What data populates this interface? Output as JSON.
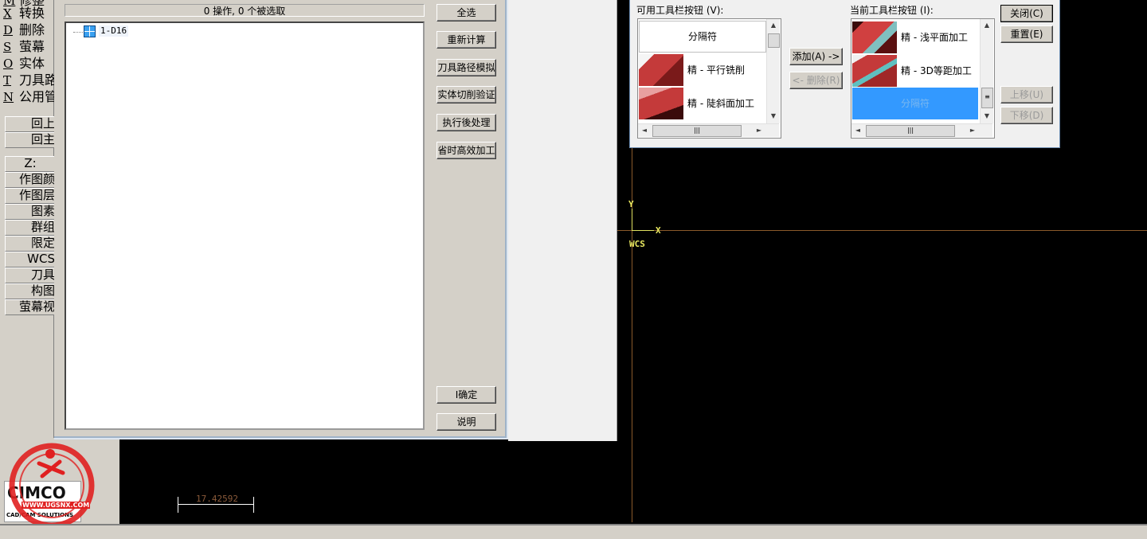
{
  "left_menu": {
    "items": [
      {
        "key": "X",
        "label": "转换"
      },
      {
        "key": "D",
        "label": "删除"
      },
      {
        "key": "S",
        "label": "萤幕"
      },
      {
        "key": "O",
        "label": "实体"
      },
      {
        "key": "T",
        "label": "刀具路"
      },
      {
        "key": "N",
        "label": "公用管"
      }
    ],
    "nav_buttons": [
      "回上",
      "回主"
    ],
    "status_buttons": [
      "Z:",
      "作图颜",
      "作图层",
      "图素",
      "群组",
      "限定",
      "WCS",
      "刀具",
      "构图",
      "萤幕视"
    ]
  },
  "operations_manager": {
    "status": "0 操作, 0 个被选取",
    "tree_item": "1-D16",
    "buttons": {
      "select_all": "全选",
      "regenerate": "重新计算",
      "backplot": "刀具路径模拟",
      "verify": "实体切削验证",
      "post": "执行後处理",
      "high_speed": "省时高效加工",
      "ok": "I确定",
      "help": "说明"
    }
  },
  "toolbar_dialog": {
    "available_label": "可用工具栏按钮 (V):",
    "current_label": "当前工具栏按钮 (I):",
    "available_items": [
      {
        "label": "分隔符",
        "icon": "separator"
      },
      {
        "label": "精 - 平行铣削",
        "icon": "parallel-finish-icon"
      },
      {
        "label": "精 - 陡斜面加工",
        "icon": "steep-finish-icon"
      }
    ],
    "current_items": [
      {
        "label": "精 - 浅平面加工",
        "icon": "shallow-finish-icon"
      },
      {
        "label": "精 - 3D等距加工",
        "icon": "3d-offset-finish-icon"
      },
      {
        "label": "分隔符",
        "icon": "separator",
        "selected": true
      }
    ],
    "buttons": {
      "add": "添加(A) ->",
      "remove": "<- 删除(R)",
      "close": "关闭(C)",
      "reset": "重置(E)",
      "move_up": "上移(U)",
      "move_down": "下移(D)"
    },
    "selection_color": "#3399ff"
  },
  "graphics": {
    "wcs_label": "WCS",
    "x_label": "X",
    "y_label": "Y",
    "scale_value": "17.42592",
    "axis_color": "#8a5a2a",
    "wcs_color": "#e8e860"
  },
  "logo": {
    "watermark_url": "WWW.UGSNX.COM",
    "brand": "CIMCO",
    "subtitle": "CAD/CAM SOLUTIONS"
  }
}
